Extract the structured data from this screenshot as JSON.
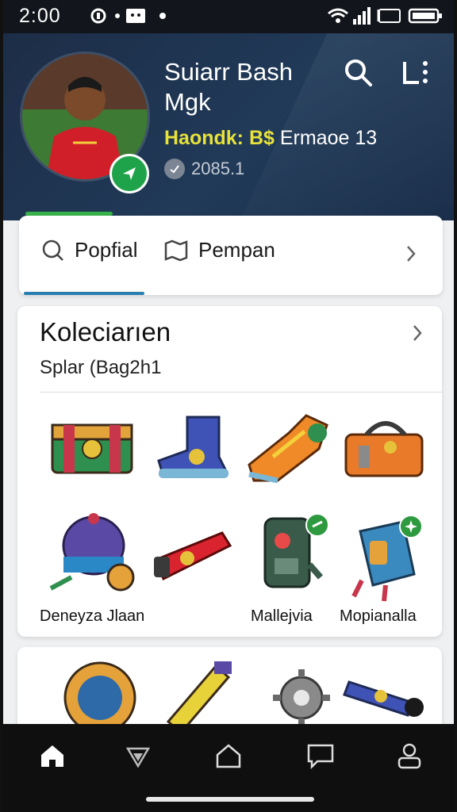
{
  "status_bar": {
    "time": "2:00"
  },
  "profile": {
    "name_line1": "Suiarr Bash",
    "name_line2": "Mgk",
    "stat_highlight": "Haondk: B$",
    "stat_extra": "Ermaoe 13",
    "sub_value": "2085.1"
  },
  "tabs": [
    {
      "label": "Popfial",
      "icon": "search-icon"
    },
    {
      "label": "Pempan",
      "icon": "map-icon"
    }
  ],
  "collection": {
    "title": "Koleciarıen",
    "subtitle": "Splar (Bag2h1",
    "items": [
      {
        "name": "chest-item",
        "label": ""
      },
      {
        "name": "boot-item",
        "label": ""
      },
      {
        "name": "sneaker-item",
        "label": ""
      },
      {
        "name": "bag-item",
        "label": ""
      },
      {
        "name": "carriage-item",
        "label": "Deneyza Jlaan"
      },
      {
        "name": "rocket-item",
        "label": ""
      },
      {
        "name": "robot-item",
        "label": "Mallejvia"
      },
      {
        "name": "backpack-item",
        "label": "Mopianalla"
      }
    ]
  },
  "nav": [
    "home",
    "explore",
    "store",
    "messages",
    "profile"
  ],
  "colors": {
    "header": "#1f3550",
    "accent": "#2a7fb0",
    "green": "#1fa34a",
    "yellow": "#e8e23a"
  }
}
